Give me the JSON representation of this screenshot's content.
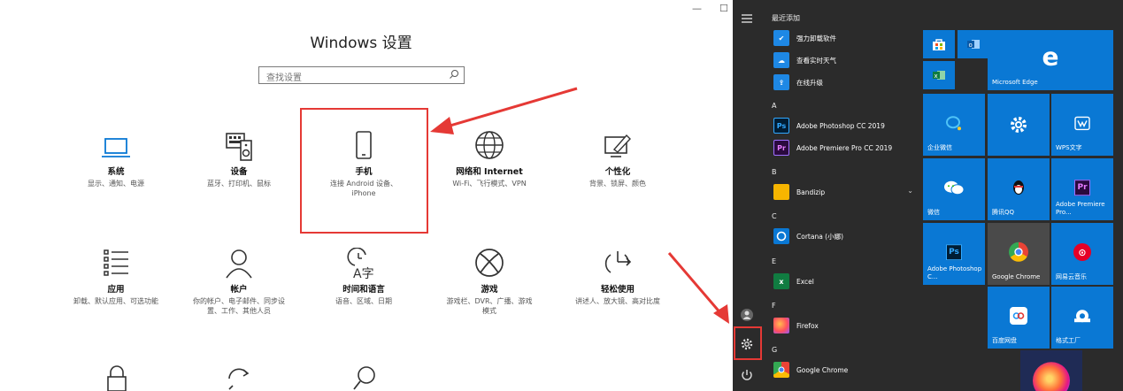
{
  "settings": {
    "window_minimize": "—",
    "window_maximize": "☐",
    "title": "Windows 设置",
    "search_placeholder": "查找设置",
    "tiles": [
      {
        "title": "系统",
        "desc": "显示、通知、电源"
      },
      {
        "title": "设备",
        "desc": "蓝牙、打印机、鼠标"
      },
      {
        "title": "手机",
        "desc": "连接 Android 设备、iPhone"
      },
      {
        "title": "网络和 Internet",
        "desc": "Wi-Fi、飞行模式、VPN"
      },
      {
        "title": "个性化",
        "desc": "背景、锁屏、颜色"
      },
      {
        "title": "应用",
        "desc": "卸载、默认应用、可选功能"
      },
      {
        "title": "帐户",
        "desc": "你的帐户、电子邮件、同步设置、工作、其他人员"
      },
      {
        "title": "时间和语言",
        "desc": "语音、区域、日期"
      },
      {
        "title": "游戏",
        "desc": "游戏栏、DVR、广播、游戏模式"
      },
      {
        "title": "轻松使用",
        "desc": "讲述人、放大镜、高对比度"
      }
    ]
  },
  "start_menu": {
    "recently_added": "最近添加",
    "recent_apps": [
      "强力卸载软件",
      "查看实时天气",
      "在线升级"
    ],
    "groups": [
      {
        "letter": "A",
        "apps": [
          "Adobe Photoshop CC 2019",
          "Adobe Premiere Pro CC 2019"
        ]
      },
      {
        "letter": "B",
        "apps": [
          "Bandizip"
        ]
      },
      {
        "letter": "C",
        "apps": [
          "Cortana (小娜)"
        ]
      },
      {
        "letter": "E",
        "apps": [
          "Excel"
        ]
      },
      {
        "letter": "F",
        "apps": [
          "Firefox"
        ]
      },
      {
        "letter": "G",
        "apps": [
          "Google Chrome"
        ]
      }
    ],
    "tiles": {
      "edge": "Microsoft Edge",
      "wechat_work": "企业微信",
      "wps": "WPS文字",
      "wechat": "微信",
      "qq": "腾讯QQ",
      "premiere": "Adobe Premiere Pro...",
      "photoshop": "Adobe Photoshop C...",
      "chrome": "Google Chrome",
      "netease": "网易云音乐",
      "baidu": "百度网盘",
      "format_factory": "格式工厂"
    }
  },
  "colors": {
    "tile_blue": "#0a78d4",
    "start_bg": "#2b2b2b",
    "highlight_red": "#e53935"
  }
}
